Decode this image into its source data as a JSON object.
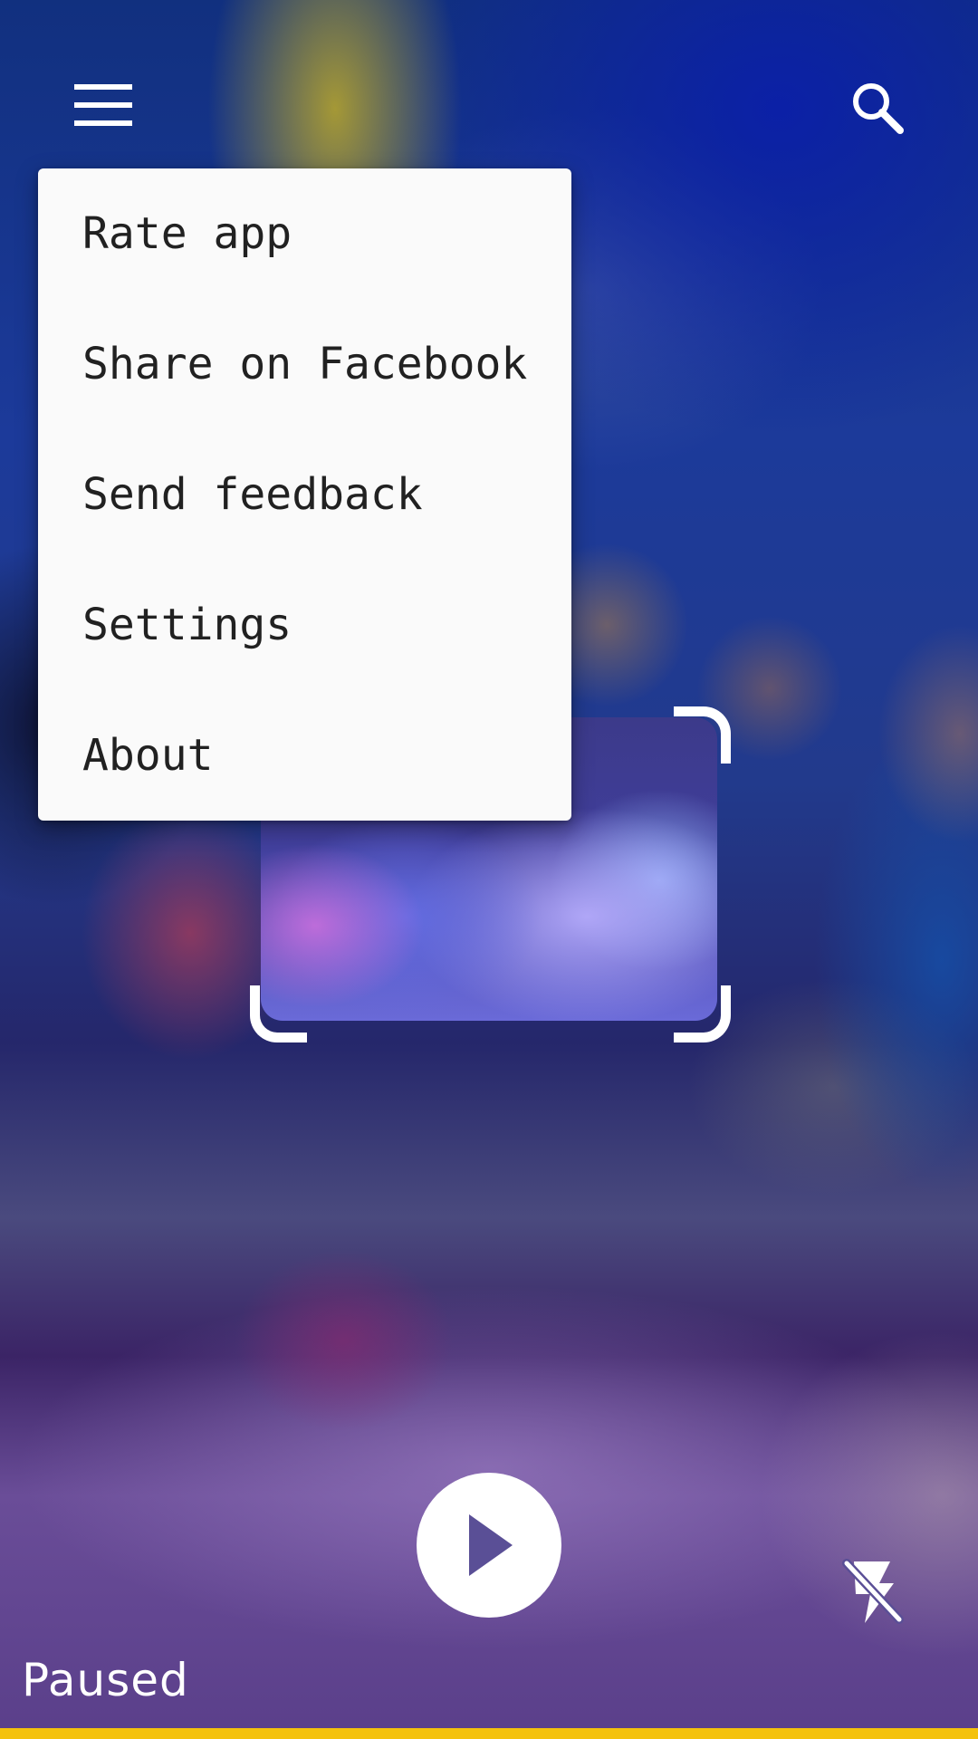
{
  "header": {
    "menu_icon": "hamburger-menu-icon",
    "search_icon": "search-icon"
  },
  "popup_menu": {
    "items": [
      {
        "label": "Rate app"
      },
      {
        "label": "Share on Facebook"
      },
      {
        "label": "Send feedback"
      },
      {
        "label": "Settings"
      },
      {
        "label": "About"
      }
    ]
  },
  "scanner": {
    "frame": "scan-frame",
    "play_icon": "play-icon",
    "flash_icon": "flash-off-icon"
  },
  "status": {
    "text": "Paused",
    "progress_fraction": 1.0
  },
  "colors": {
    "accent": "#f4c20d",
    "menu_background": "#fafafa",
    "menu_text": "#212121",
    "icon": "#ffffff"
  }
}
